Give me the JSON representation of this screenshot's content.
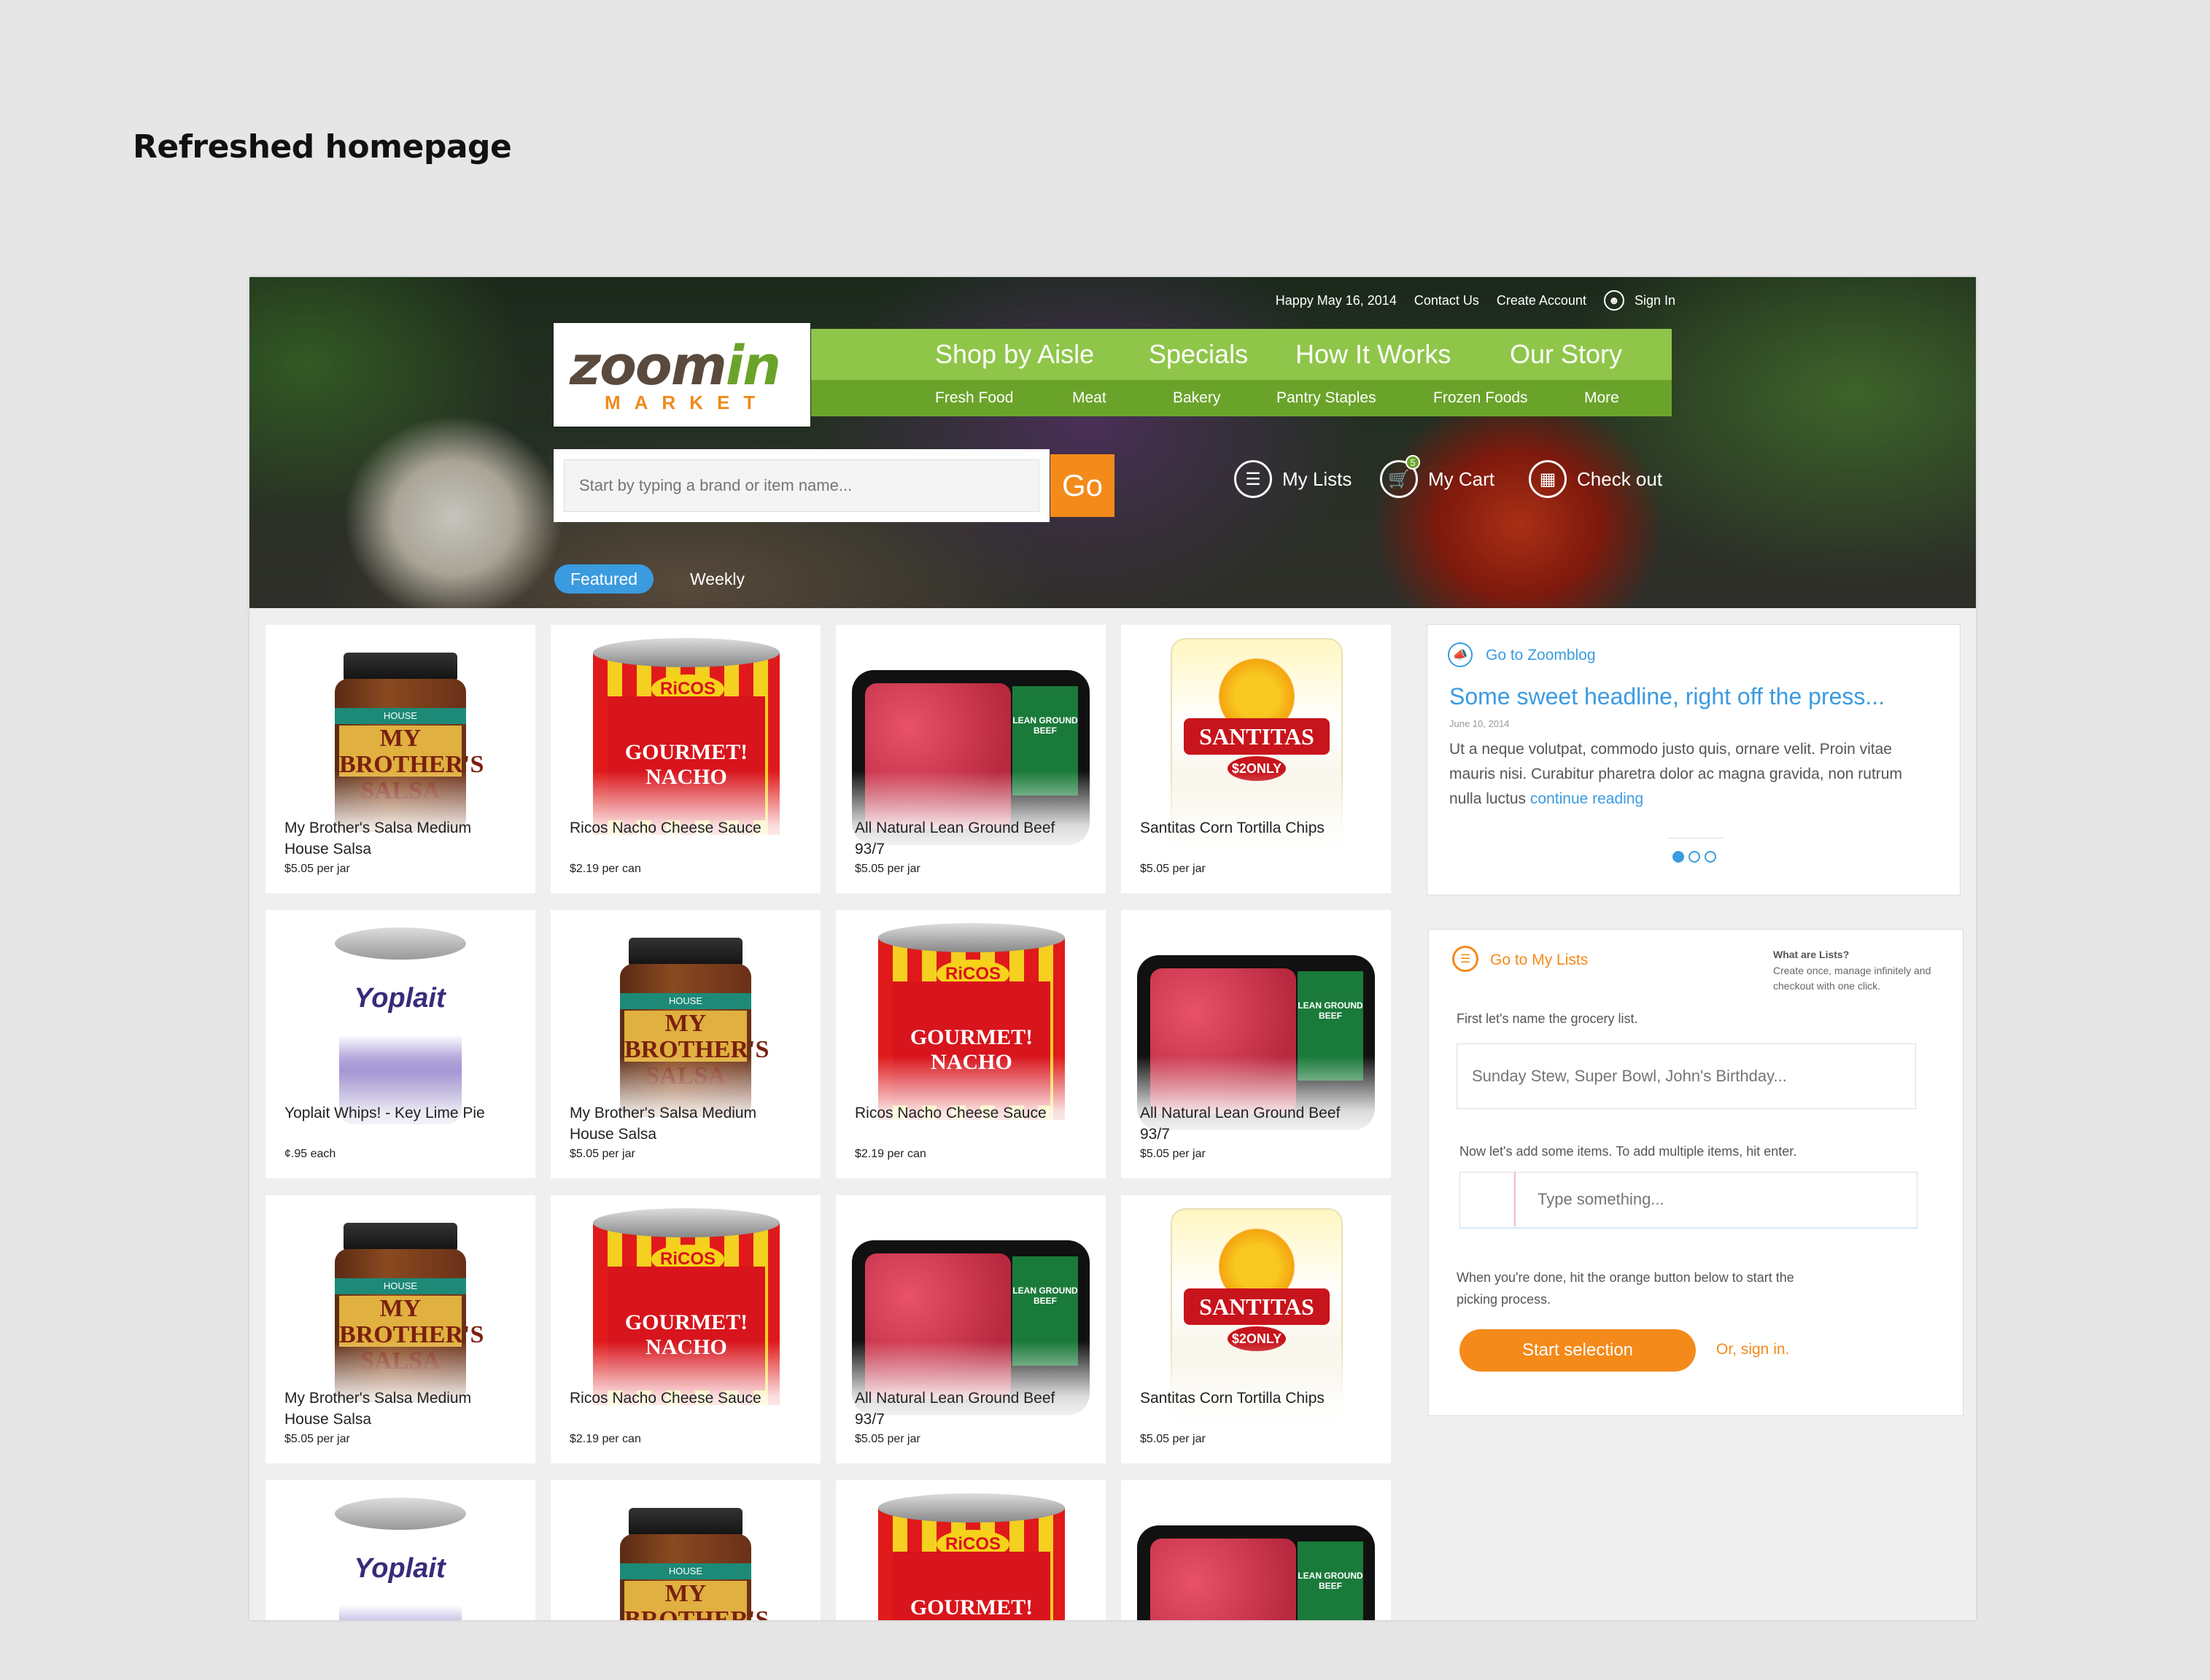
{
  "page_title": "Refreshed homepage",
  "header": {
    "greeting": "Happy May 16, 2014",
    "contact": "Contact Us",
    "create_account": "Create Account",
    "sign_in": "Sign In",
    "user_icon": "user-icon"
  },
  "logo": {
    "zoom": "zoom",
    "in": "in",
    "market": "MARKET"
  },
  "nav": {
    "main": [
      "Shop by Aisle",
      "Specials",
      "How It Works",
      "Our Story"
    ],
    "sub": [
      "Fresh Food",
      "Meat",
      "Bakery",
      "Pantry Staples",
      "Frozen Foods",
      "More"
    ],
    "colors": {
      "main": "#8fc64a",
      "sub": "#6aa32a"
    }
  },
  "search": {
    "placeholder": "Start by typing a brand or item name...",
    "go_label": "Go"
  },
  "actions": {
    "my_lists": "My Lists",
    "my_cart": "My Cart",
    "cart_count": "5",
    "checkout": "Check out"
  },
  "tabs": {
    "featured": "Featured",
    "weekly": "Weekly"
  },
  "products": [
    {
      "name": "My Brother's Salsa Medium House Salsa",
      "price": "$5.05 per jar",
      "kind": "jar",
      "label": "MY BROTHER'S SALSA",
      "band": "HOUSE"
    },
    {
      "name": "Ricos Nacho Cheese Sauce",
      "price": "$2.19 per can",
      "kind": "can",
      "label": "GOURMET! NACHO",
      "brand": "RiCOS"
    },
    {
      "name": "All Natural Lean Ground Beef 93/7",
      "price": "$5.05 per jar",
      "kind": "tray",
      "label": "LEAN GROUND BEEF"
    },
    {
      "name": "Santitas Corn Tortilla Chips",
      "price": "$5.05 per jar",
      "kind": "bag",
      "label": "SANTITAS",
      "badge": "$2ONLY"
    },
    {
      "name": "Yoplait Whips! - Key Lime Pie",
      "price": "¢.95 each",
      "kind": "cup",
      "label": "Yoplait"
    },
    {
      "name": "My Brother's Salsa Medium House Salsa",
      "price": "$5.05 per jar",
      "kind": "jar",
      "label": "MY BROTHER'S SALSA",
      "band": "HOUSE"
    },
    {
      "name": "Ricos Nacho Cheese Sauce",
      "price": "$2.19 per can",
      "kind": "can",
      "label": "GOURMET! NACHO",
      "brand": "RiCOS"
    },
    {
      "name": "All Natural Lean Ground Beef 93/7",
      "price": "$5.05 per jar",
      "kind": "tray",
      "label": "LEAN GROUND BEEF"
    },
    {
      "name": "My Brother's Salsa Medium House Salsa",
      "price": "$5.05 per jar",
      "kind": "jar",
      "label": "MY BROTHER'S SALSA",
      "band": "HOUSE"
    },
    {
      "name": "Ricos Nacho Cheese Sauce",
      "price": "$2.19 per can",
      "kind": "can",
      "label": "GOURMET! NACHO",
      "brand": "RiCOS"
    },
    {
      "name": "All Natural Lean Ground Beef 93/7",
      "price": "$5.05 per jar",
      "kind": "tray",
      "label": "LEAN GROUND BEEF"
    },
    {
      "name": "Santitas Corn Tortilla Chips",
      "price": "$5.05 per jar",
      "kind": "bag",
      "label": "SANTITAS",
      "badge": "$2ONLY"
    },
    {
      "name": "",
      "price": "",
      "kind": "cup",
      "label": "Yoplait"
    },
    {
      "name": "",
      "price": "",
      "kind": "jar",
      "label": "MY BROTHER'S",
      "band": "HOUSE"
    },
    {
      "name": "",
      "price": "",
      "kind": "can",
      "label": "GOURMET!",
      "brand": "RiCOS"
    },
    {
      "name": "",
      "price": "",
      "kind": "tray",
      "label": "LEAN GROUND BEEF"
    }
  ],
  "blog": {
    "link": "Go to Zoomblog",
    "headline": "Some sweet headline, right off the press...",
    "date": "June 10, 2014",
    "body": "Ut a neque volutpat, commodo justo quis, ornare velit. Proin vitae mauris nisi. Curabitur pharetra dolor ac magna gravida, non rutrum nulla luctus ",
    "more": "continue reading",
    "active_slide": 1,
    "slide_count": 3
  },
  "lists": {
    "link": "Go to My Lists",
    "what_title": "What are Lists?",
    "what_body": "Create once, manage infinitely and checkout with one click.",
    "step1": "First let's name the grocery list.",
    "name_placeholder": "Sunday Stew, Super Bowl, John's Birthday...",
    "step2": "Now let's add some items. To add multiple items, hit enter.",
    "item_placeholder": "Type something...",
    "step3": "When you're done, hit the orange button below to start the picking process.",
    "start_label": "Start selection",
    "signin": "Or, sign in."
  }
}
